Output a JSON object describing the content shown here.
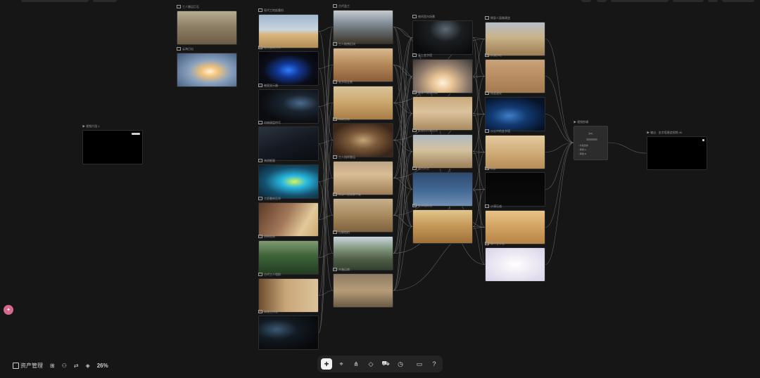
{
  "app": {
    "name": "Node canvas workflow editor"
  },
  "bottom_left": {
    "asset_manager_label": "资产管理",
    "zoom": "26%"
  },
  "toolbar": {
    "items": [
      {
        "name": "add-node-button",
        "glyph": "+"
      },
      {
        "name": "select-pointer-button",
        "glyph": "⌖"
      },
      {
        "name": "share-button",
        "glyph": "⋔"
      },
      {
        "name": "shapes-button",
        "glyph": "◇"
      },
      {
        "name": "model-button",
        "glyph": "⛟"
      },
      {
        "name": "history-button",
        "glyph": "◷"
      },
      {
        "name": "preview-button",
        "glyph": "▭"
      },
      {
        "name": "help-button",
        "glyph": "?"
      }
    ]
  },
  "nodes": {
    "text_input": {
      "title": "▶ 视频片段 1",
      "dim": ""
    },
    "merge": {
      "title": "▶ 视频剪辑",
      "options": [
        "• 片段合并",
        "• 转场 A",
        "• 转场 B"
      ]
    },
    "output": {
      "title": "▶ 输出 · 金字塔建造视频 4K",
      "dim": ""
    },
    "col0": [
      {
        "title": "工人搬运巨石",
        "scene": "workers"
      },
      {
        "title": "云海日出",
        "scene": "clouds"
      }
    ],
    "col1": [
      {
        "title": "现代工地起重机",
        "scene": "crane"
      },
      {
        "title": "发光悬浮方块",
        "scene": "blue_device"
      },
      {
        "title": "暗室显示器",
        "scene": "dark_monitor"
      },
      {
        "title": "机械键盘特写",
        "scene": "keyboard"
      },
      {
        "title": "海浪能量",
        "scene": "wave"
      },
      {
        "title": "工匠雕刻石块",
        "scene": "man_rock"
      },
      {
        "title": "热带雨林",
        "scene": "forest"
      },
      {
        "title": "古代工人墙前",
        "scene": "workers_wall"
      },
      {
        "title": "深夜工作室",
        "scene": "dark_room"
      }
    ],
    "col2": [
      {
        "title": "古代监工",
        "scene": "overseer"
      },
      {
        "title": "工人拖拽石块",
        "scene": "pulling"
      },
      {
        "title": "金字塔全景",
        "scene": "pyramid_sand"
      },
      {
        "title": "陶碗谷物",
        "scene": "bowl"
      },
      {
        "title": "工人指挥搬运",
        "scene": "man_pointing"
      },
      {
        "title": "狮身人面像脚手架",
        "scene": "sphinx_scaffold"
      },
      {
        "title": "山脉航拍",
        "scene": "mountains"
      },
      {
        "title": "木箱运输",
        "scene": "crates"
      }
    ],
    "col3": [
      {
        "title": "夜间室内场景",
        "scene": "night_room"
      },
      {
        "title": "云上金字塔",
        "scene": "pyramid_clouds"
      },
      {
        "title": "狮身人面像正面",
        "scene": "sphinx"
      },
      {
        "title": "挖掘机吊装石块",
        "scene": "excavator"
      },
      {
        "title": "蓝色天空",
        "scene": "blue_sky"
      },
      {
        "title": "金字塔仰视",
        "scene": "pyramid_steps"
      }
    ],
    "col4": [
      {
        "title": "狮身人面像建造",
        "scene": "sphinx_build"
      },
      {
        "title": "沙漠沙地",
        "scene": "sand"
      },
      {
        "title": "深蓝波纹",
        "scene": "blue_waves"
      },
      {
        "title": "沙丘中的金字塔",
        "scene": "dune_pyramid"
      },
      {
        "title": "黑屏",
        "scene": "black"
      },
      {
        "title": "沙漠石道",
        "scene": "sand_road"
      },
      {
        "title": "雾中金字塔",
        "scene": "fog_pyramids"
      }
    ]
  }
}
